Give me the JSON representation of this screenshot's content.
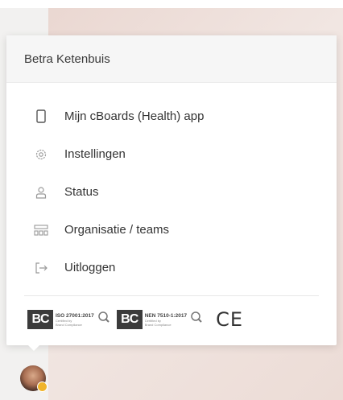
{
  "user": {
    "name": "Betra Ketenbuis"
  },
  "menu": {
    "items": [
      {
        "icon": "phone-icon",
        "label": "Mijn cBoards (Health) app"
      },
      {
        "icon": "gear-icon",
        "label": "Instellingen"
      },
      {
        "icon": "user-icon",
        "label": "Status"
      },
      {
        "icon": "organization-icon",
        "label": "Organisatie / teams"
      },
      {
        "icon": "logout-icon",
        "label": "Uitloggen"
      }
    ]
  },
  "certifications": [
    {
      "logo": "BC",
      "standard": "ISO 27001:2017",
      "certified_by": "Certified by",
      "issuer": "Brand Compliance"
    },
    {
      "logo": "BC",
      "standard": "NEN 7510-1:2017",
      "certified_by": "Certified by",
      "issuer": "Brand Compliance"
    }
  ],
  "ce_mark": "CE"
}
